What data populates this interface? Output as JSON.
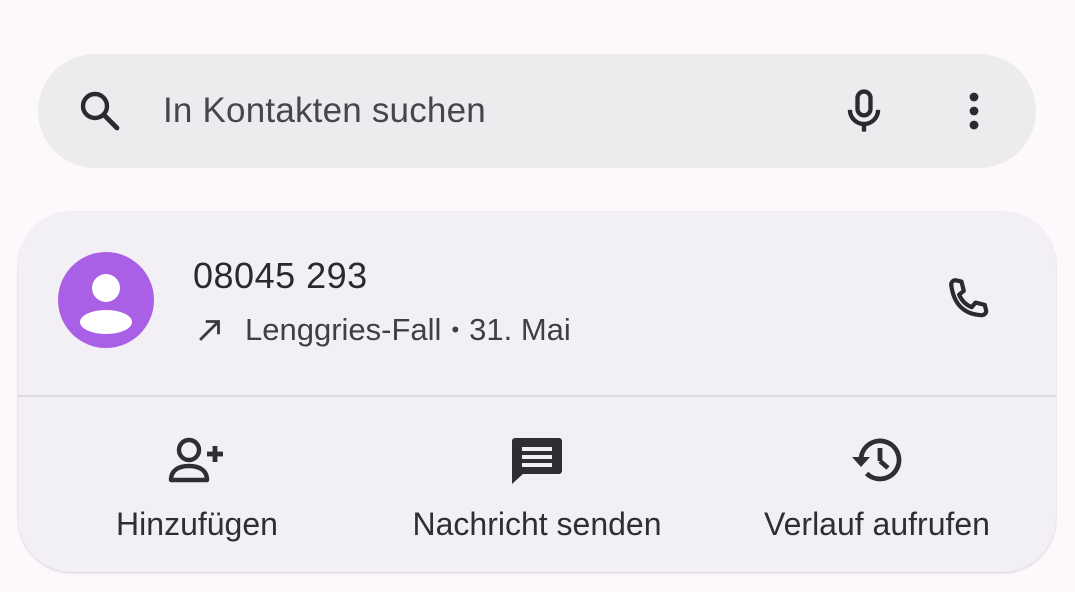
{
  "search": {
    "placeholder": "In Kontakten suchen",
    "search_icon": "search-icon",
    "mic_icon": "mic-icon",
    "more_icon": "more-vert-icon"
  },
  "call_entry": {
    "number": "08045 293",
    "direction_icon": "outgoing-call-arrow-icon",
    "location": "Lenggries-Fall",
    "separator": "•",
    "date": "31. Mai",
    "avatar_color": "#a960e6",
    "call_icon": "phone-icon"
  },
  "actions": [
    {
      "label": "Hinzufügen",
      "icon": "person-add-icon"
    },
    {
      "label": "Nachricht senden",
      "icon": "message-icon"
    },
    {
      "label": "Verlauf aufrufen",
      "icon": "history-icon"
    }
  ]
}
